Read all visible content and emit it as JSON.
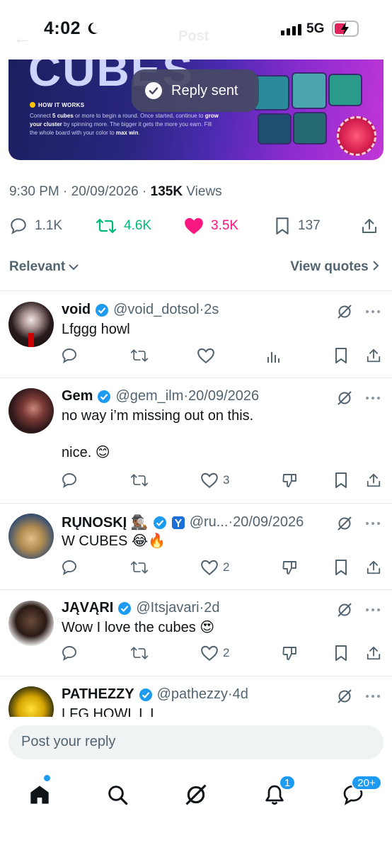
{
  "status": {
    "time": "4:02",
    "network": "5G"
  },
  "header": {
    "title": "Post"
  },
  "banner": {
    "headline": "CUBES",
    "how_title": "HOW IT WORKS",
    "how_text_1": "Connect ",
    "how_bold_1": "5 cubes",
    "how_text_2": " or more to begin a round. Once started, continue to ",
    "how_bold_2": "grow your cluster",
    "how_text_3": " by spinning more. The bigger it gets the more you earn. Fill the whole board with your color to ",
    "how_bold_3": "max win",
    "how_text_4": "."
  },
  "toast": {
    "text": "Reply sent"
  },
  "post_meta": {
    "time": "9:30 PM",
    "date": "20/09/2026",
    "views": "135K",
    "views_label": "Views"
  },
  "stats": {
    "replies": "1.1K",
    "reposts": "4.6K",
    "likes": "3.5K",
    "bookmarks": "137"
  },
  "sort": {
    "relevant": "Relevant",
    "view_quotes": "View quotes"
  },
  "replies": [
    {
      "name": "void",
      "handle": "@void_dotsol",
      "time": "2s",
      "text": "Lfggg howl",
      "likes": ""
    },
    {
      "name": "Gem",
      "handle": "@gem_ilm",
      "time": "20/09/2026",
      "text": "no way i’m missing out on this.\n\nnice.  😊",
      "likes": "3"
    },
    {
      "name": "RŲNOSKĮ 🕵🏾‍♂️",
      "handle": "@ru...",
      "time": "20/09/2026",
      "text": "W CUBES 😂🔥",
      "likes": "2"
    },
    {
      "name": "JĄVĄRI",
      "handle": "@Itsjavari",
      "time": "2d",
      "text": "Wow I love the cubes 😍",
      "likes": "2"
    },
    {
      "name": "PATHEZZY",
      "handle": "@pathezzy",
      "time": "4d",
      "text": "LFG HOWL L L",
      "likes": ""
    }
  ],
  "reply_bar": {
    "placeholder": "Post your reply"
  },
  "tabs": {
    "notifications_badge": "1",
    "messages_badge": "20+"
  },
  "colors": {
    "accent": "#1d9bf0",
    "repost": "#00ba7c",
    "like": "#f91880",
    "muted": "#536471"
  }
}
